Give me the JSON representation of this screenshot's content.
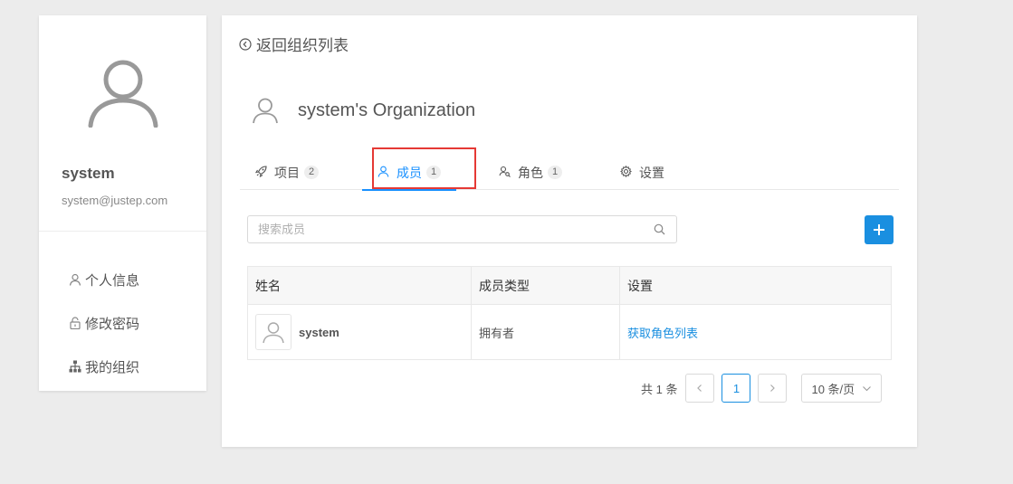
{
  "profile": {
    "name": "system",
    "email": "system@justep.com",
    "menu": [
      {
        "label": "个人信息",
        "icon": "user-icon"
      },
      {
        "label": "修改密码",
        "icon": "lock-icon"
      },
      {
        "label": "我的组织",
        "icon": "org-tree-icon"
      }
    ]
  },
  "main": {
    "back_label": "返回组织列表",
    "org_title": "system's Organization",
    "tabs": [
      {
        "label": "项目",
        "count": "2",
        "icon": "rocket-icon"
      },
      {
        "label": "成员",
        "count": "1",
        "icon": "user-icon",
        "active": true
      },
      {
        "label": "角色",
        "count": "1",
        "icon": "roles-icon"
      },
      {
        "label": "设置",
        "count": "",
        "icon": "gear-icon"
      }
    ],
    "search_placeholder": "搜索成员",
    "table": {
      "headers": [
        "姓名",
        "成员类型",
        "设置"
      ],
      "rows": [
        {
          "name": "system",
          "type": "拥有者",
          "action": "获取角色列表"
        }
      ]
    },
    "pagination": {
      "total_text": "共 1 条",
      "current_page": "1",
      "page_size": "10 条/页"
    }
  },
  "colors": {
    "accent": "#1a8fe0",
    "highlight": "#e53935"
  }
}
